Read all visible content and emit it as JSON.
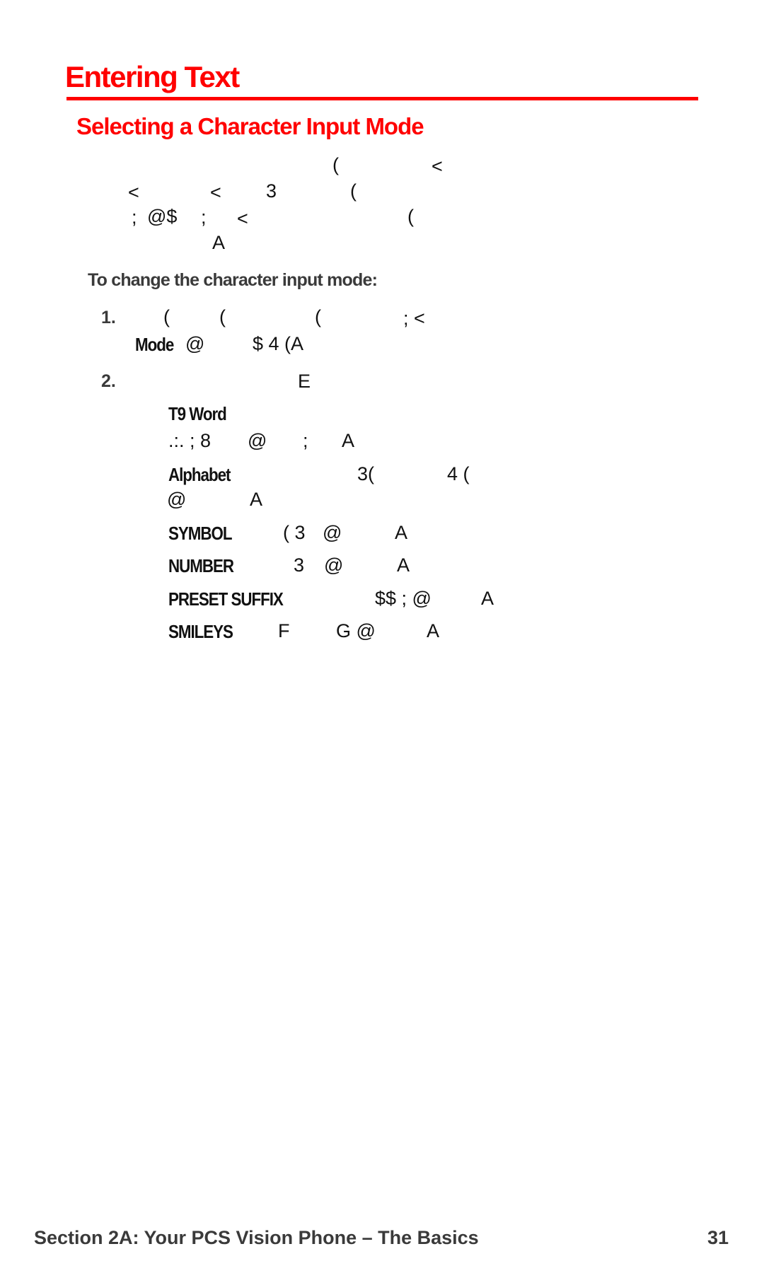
{
  "page": {
    "title": "Entering Text",
    "subtitle": "Selecting a Character Input Mode",
    "accent_color": "#ff0000"
  },
  "intro_paragraph": {
    "lines": [
      [
        {
          "t": "("
        },
        {
          "t": "<"
        }
      ],
      [
        {
          "t": "<"
        },
        {
          "t": "<"
        },
        {
          "t": "3"
        },
        {
          "t": "("
        }
      ],
      [
        {
          "t": ";"
        },
        {
          "t": "@$"
        },
        {
          "t": ";"
        },
        {
          "t": "<"
        },
        {
          "t": "("
        }
      ],
      [
        {
          "t": "A"
        }
      ]
    ]
  },
  "procedure": {
    "lead": "To change the character input mode:",
    "steps": [
      {
        "number": "1.",
        "line1": [
          "(",
          "(",
          "(",
          "; <"
        ],
        "line2_bold": "Mode",
        "line2": [
          "@",
          "$ 4 (A"
        ]
      },
      {
        "number": "2.",
        "line1": [
          "E"
        ]
      }
    ],
    "options": [
      {
        "term": "T9 Word",
        "line1": [],
        "line2": [
          ".:. ; 8",
          "@",
          ";",
          "A"
        ]
      },
      {
        "term": "Alphabet",
        "line1": [
          "3(",
          "4 ("
        ],
        "line2": [
          "@",
          "A"
        ]
      },
      {
        "term": "SYMBOL",
        "line1": [
          "( 3",
          "@",
          "A"
        ]
      },
      {
        "term": "NUMBER",
        "line1": [
          "3",
          "@",
          "A"
        ]
      },
      {
        "term": "PRESET SUFFIX",
        "line1": [
          "$$ ; @",
          "A"
        ]
      },
      {
        "term": "SMILEYS",
        "line1": [
          "F",
          "G @",
          "A"
        ]
      }
    ]
  },
  "footer": {
    "section": "Section 2A: Your PCS Vision Phone – The Basics",
    "page_number": "31"
  }
}
